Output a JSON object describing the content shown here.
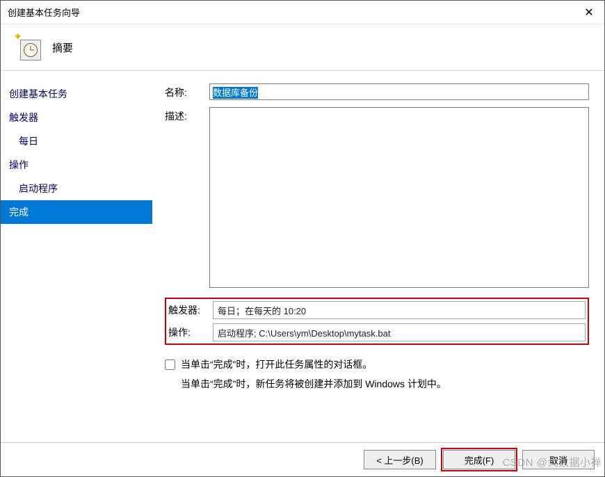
{
  "window": {
    "title": "创建基本任务向导",
    "close_symbol": "✕"
  },
  "header": {
    "title": "摘要",
    "spark": "✦"
  },
  "sidebar": {
    "items": [
      {
        "label": "创建基本任务",
        "sub": false,
        "active": false
      },
      {
        "label": "触发器",
        "sub": false,
        "active": false
      },
      {
        "label": "每日",
        "sub": true,
        "active": false
      },
      {
        "label": "操作",
        "sub": false,
        "active": false
      },
      {
        "label": "启动程序",
        "sub": true,
        "active": false
      },
      {
        "label": "完成",
        "sub": false,
        "active": true
      }
    ]
  },
  "form": {
    "name_label": "名称:",
    "name_value": "数据库备份",
    "desc_label": "描述:",
    "desc_value": "",
    "trigger_label": "触发器:",
    "trigger_value": "每日；在每天的 10:20",
    "action_label": "操作:",
    "action_value": "启动程序; C:\\Users\\ym\\Desktop\\mytask.bat",
    "checkbox_label": "当单击“完成”时，打开此任务属性的对话框。",
    "note_text": "当单击“完成”时，新任务将被创建并添加到 Windows 计划中。"
  },
  "footer": {
    "back": "< 上一步(B)",
    "finish": "完成(F)",
    "cancel": "取消"
  },
  "watermark": "CSDN @大数据小禅"
}
